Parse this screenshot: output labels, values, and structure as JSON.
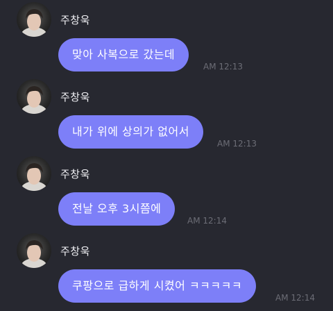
{
  "messages": [
    {
      "sender": "주창욱",
      "text": "맞아 사복으로 갔는데",
      "time": "AM 12:13"
    },
    {
      "sender": "주창욱",
      "text": "내가 위에 상의가 없어서",
      "time": "AM 12:13"
    },
    {
      "sender": "주창욱",
      "text": "전날 오후 3시쯤에",
      "time": "AM 12:14"
    },
    {
      "sender": "주창욱",
      "text": "쿠팡으로 급하게 시켰어 ㅋㅋㅋㅋㅋ",
      "time": "AM 12:14"
    }
  ],
  "colors": {
    "background": "#272830",
    "bubble": "#7d7ff8",
    "bubble_text": "#ffffff",
    "sender_text": "#f1f1f5",
    "timestamp_text": "#6c6d76"
  },
  "icons": {
    "avatar": "profile-photo-icon"
  }
}
